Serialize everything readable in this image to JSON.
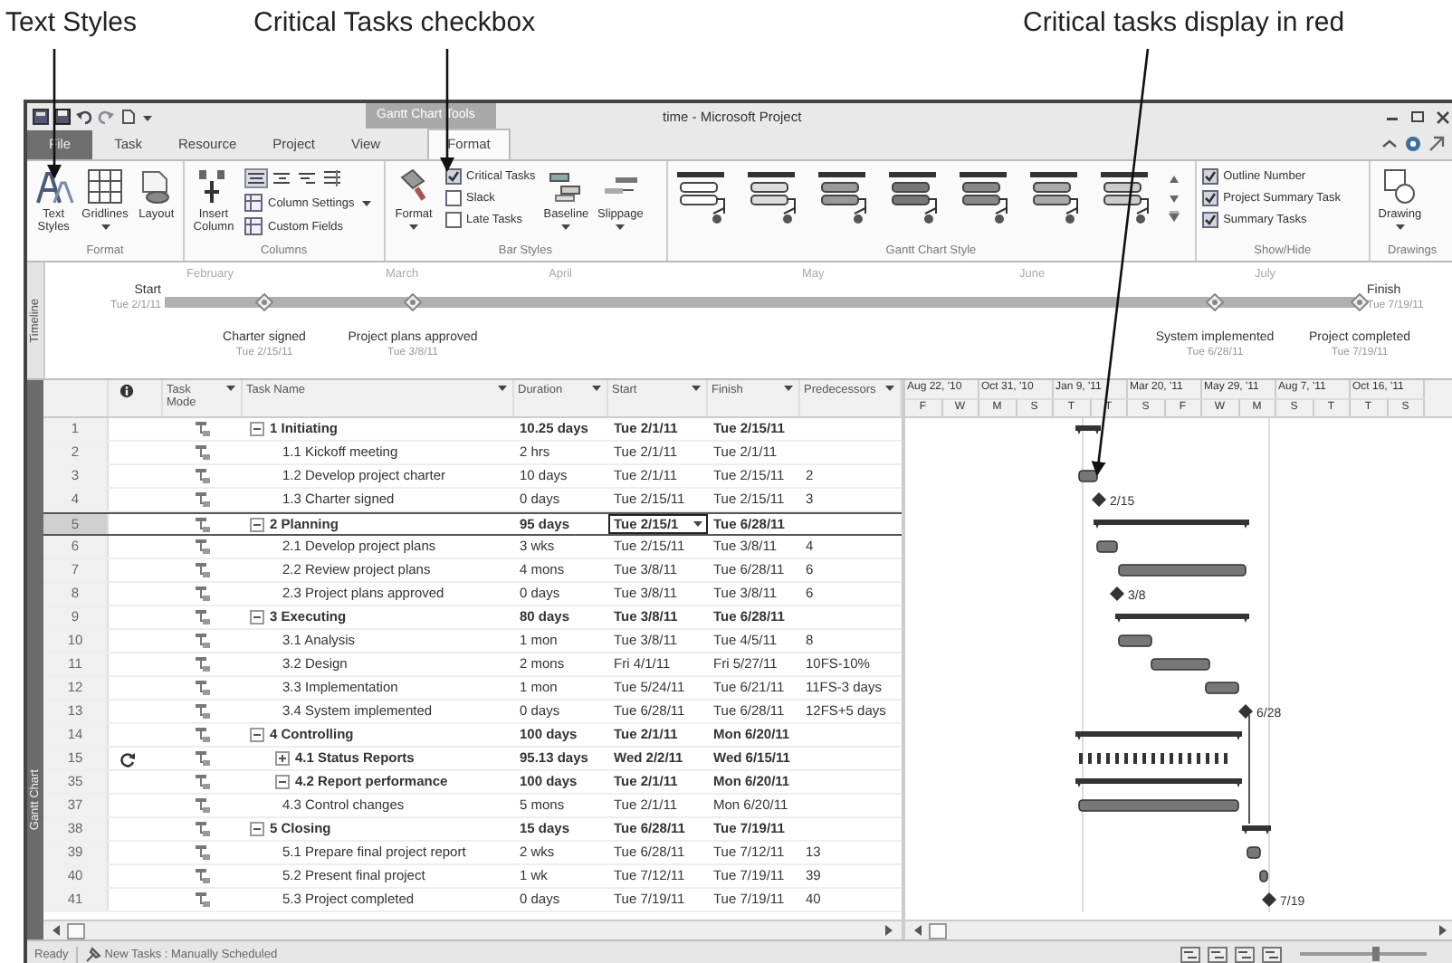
{
  "callouts": [
    {
      "text": "Text Styles"
    },
    {
      "text": "Critical Tasks checkbox"
    },
    {
      "text": "Critical tasks display in red"
    }
  ],
  "window": {
    "title": "time - Microsoft Project",
    "context_tab": "Gantt Chart Tools"
  },
  "tabs": [
    {
      "label": "File",
      "kind": "file",
      "selected": false
    },
    {
      "label": "Task",
      "kind": "tab",
      "selected": false
    },
    {
      "label": "Resource",
      "kind": "tab",
      "selected": false
    },
    {
      "label": "Project",
      "kind": "tab",
      "selected": false
    },
    {
      "label": "View",
      "kind": "tab",
      "selected": false
    },
    {
      "label": "Format",
      "kind": "tab",
      "selected": true
    }
  ],
  "ribbon": {
    "groups": [
      {
        "label": "Format",
        "items": [
          {
            "kind": "large",
            "label": "Text Styles",
            "dropdown": false
          },
          {
            "kind": "large",
            "label": "Gridlines",
            "dropdown": true
          },
          {
            "kind": "large",
            "label": "Layout",
            "dropdown": false
          }
        ]
      },
      {
        "label": "Columns",
        "items": [
          {
            "kind": "large",
            "label": "Insert Column",
            "dropdown": false
          },
          {
            "kind": "align"
          },
          {
            "kind": "small",
            "label": "Column Settings",
            "dropdown": true
          },
          {
            "kind": "small",
            "label": "Custom Fields",
            "dropdown": false
          }
        ]
      },
      {
        "label": "Bar Styles",
        "items": [
          {
            "kind": "large",
            "label": "Format",
            "dropdown": true
          },
          {
            "kind": "check",
            "label": "Critical Tasks",
            "checked": true
          },
          {
            "kind": "check",
            "label": "Slack",
            "checked": false
          },
          {
            "kind": "check",
            "label": "Late Tasks",
            "checked": false
          },
          {
            "kind": "large",
            "label": "Baseline",
            "dropdown": true
          },
          {
            "kind": "large",
            "label": "Slippage",
            "dropdown": true
          }
        ]
      },
      {
        "label": "Gantt Chart Style",
        "items": [
          {
            "kind": "gallery"
          }
        ]
      },
      {
        "label": "Show/Hide",
        "items": [
          {
            "kind": "check",
            "label": "Outline Number",
            "checked": true
          },
          {
            "kind": "check",
            "label": "Project Summary Task",
            "checked": true
          },
          {
            "kind": "check",
            "label": "Summary Tasks",
            "checked": true
          }
        ]
      },
      {
        "label": "Drawings",
        "items": [
          {
            "kind": "large",
            "label": "Drawing",
            "dropdown": true
          }
        ]
      }
    ]
  },
  "timeline": {
    "side_label": "Timeline",
    "months": [
      "February",
      "March",
      "April",
      "May",
      "June",
      "July"
    ],
    "start": {
      "label": "Start",
      "date": "Tue 2/1/11"
    },
    "finish": {
      "label": "Finish",
      "date": "Tue 7/19/11"
    },
    "milestones": [
      {
        "name": "Charter signed",
        "date": "Tue 2/15/11"
      },
      {
        "name": "Project plans approved",
        "date": "Tue 3/8/11"
      },
      {
        "name": "System implemented",
        "date": "Tue 6/28/11"
      },
      {
        "name": "Project completed",
        "date": "Tue 7/19/11"
      }
    ]
  },
  "view_bar": {
    "label": "Gantt Chart"
  },
  "table": {
    "columns": [
      {
        "kind": "indicator"
      },
      {
        "kind": "text",
        "label": "Task Mode"
      },
      {
        "kind": "text",
        "label": "Task Name"
      },
      {
        "kind": "text",
        "label": "Duration"
      },
      {
        "kind": "text",
        "label": "Start"
      },
      {
        "kind": "text",
        "label": "Finish"
      },
      {
        "kind": "text",
        "label": "Predecessors"
      }
    ],
    "rows": [
      {
        "id": "1",
        "name": "1 Initiating",
        "duration": "10.25 days",
        "start": "Tue 2/1/11",
        "finish": "Tue 2/15/11",
        "summary": true,
        "expanded": true,
        "recurring": false,
        "selected": false,
        "children": [
          {
            "id": "2",
            "name": "1.1 Kickoff meeting",
            "duration": "2 hrs",
            "start": "Tue 2/1/11",
            "finish": "Tue 2/1/11",
            "summary": false,
            "recurring": false,
            "selected": false
          },
          {
            "id": "3",
            "name": "1.2 Develop project charter",
            "duration": "10 days",
            "start": "Tue 2/1/11",
            "finish": "Tue 2/15/11",
            "predecessors": "2",
            "summary": false,
            "recurring": false,
            "selected": false
          },
          {
            "id": "4",
            "name": "1.3 Charter signed",
            "duration": "0 days",
            "start": "Tue 2/15/11",
            "finish": "Tue 2/15/11",
            "predecessors": "3",
            "summary": false,
            "recurring": false,
            "selected": false,
            "gantt_label": "2/15"
          }
        ]
      },
      {
        "id": "5",
        "name": "2 Planning",
        "duration": "95 days",
        "start": "Tue 2/15/1",
        "finish": "Tue 6/28/11",
        "summary": true,
        "expanded": true,
        "recurring": false,
        "selected": true,
        "children": [
          {
            "id": "6",
            "name": "2.1 Develop project plans",
            "duration": "3 wks",
            "start": "Tue 2/15/11",
            "finish": "Tue 3/8/11",
            "predecessors": "4",
            "summary": false,
            "recurring": false,
            "selected": false
          },
          {
            "id": "7",
            "name": "2.2 Review project plans",
            "duration": "4 mons",
            "start": "Tue 3/8/11",
            "finish": "Tue 6/28/11",
            "predecessors": "6",
            "summary": false,
            "recurring": false,
            "selected": false
          },
          {
            "id": "8",
            "name": "2.3 Project plans approved",
            "duration": "0 days",
            "start": "Tue 3/8/11",
            "finish": "Tue 3/8/11",
            "predecessors": "6",
            "summary": false,
            "recurring": false,
            "selected": false,
            "gantt_label": "3/8"
          }
        ]
      },
      {
        "id": "9",
        "name": "3 Executing",
        "duration": "80 days",
        "start": "Tue 3/8/11",
        "finish": "Tue 6/28/11",
        "summary": true,
        "expanded": true,
        "recurring": false,
        "selected": false,
        "children": [
          {
            "id": "10",
            "name": "3.1 Analysis",
            "duration": "1 mon",
            "start": "Tue 3/8/11",
            "finish": "Tue 4/5/11",
            "predecessors": "8",
            "summary": false,
            "recurring": false,
            "selected": false
          },
          {
            "id": "11",
            "name": "3.2 Design",
            "duration": "2 mons",
            "start": "Fri 4/1/11",
            "finish": "Fri 5/27/11",
            "predecessors": "10FS-10%",
            "summary": false,
            "recurring": false,
            "selected": false
          },
          {
            "id": "12",
            "name": "3.3 Implementation",
            "duration": "1 mon",
            "start": "Tue 5/24/11",
            "finish": "Tue 6/21/11",
            "predecessors": "11FS-3 days",
            "summary": false,
            "recurring": false,
            "selected": false
          },
          {
            "id": "13",
            "name": "3.4 System implemented",
            "duration": "0 days",
            "start": "Tue 6/28/11",
            "finish": "Tue 6/28/11",
            "predecessors": "12FS+5 days",
            "summary": false,
            "recurring": false,
            "selected": false,
            "gantt_label": "6/28"
          }
        ]
      },
      {
        "id": "14",
        "name": "4 Controlling",
        "duration": "100 days",
        "start": "Tue 2/1/11",
        "finish": "Mon 6/20/11",
        "summary": true,
        "expanded": true,
        "recurring": false,
        "selected": false,
        "children": [
          {
            "id": "15",
            "name": "4.1 Status Reports",
            "duration": "95.13 days",
            "start": "Wed 2/2/11",
            "finish": "Wed 6/15/11",
            "summary": true,
            "expanded": false,
            "recurring": true,
            "selected": false
          },
          {
            "id": "35",
            "name": "4.2 Report performance",
            "duration": "100 days",
            "start": "Tue 2/1/11",
            "finish": "Mon 6/20/11",
            "summary": true,
            "expanded": true,
            "recurring": false,
            "selected": false
          },
          {
            "id": "37",
            "name": "4.3 Control changes",
            "duration": "5 mons",
            "start": "Tue 2/1/11",
            "finish": "Mon 6/20/11",
            "summary": false,
            "recurring": false,
            "selected": false
          }
        ]
      },
      {
        "id": "38",
        "name": "5 Closing",
        "duration": "15 days",
        "start": "Tue 6/28/11",
        "finish": "Tue 7/19/11",
        "summary": true,
        "expanded": true,
        "recurring": false,
        "selected": false,
        "children": [
          {
            "id": "39",
            "name": "5.1 Prepare final project report",
            "duration": "2 wks",
            "start": "Tue 6/28/11",
            "finish": "Tue 7/12/11",
            "predecessors": "13",
            "summary": false,
            "recurring": false,
            "selected": false
          },
          {
            "id": "40",
            "name": "5.2 Present final project",
            "duration": "1 wk",
            "start": "Tue 7/12/11",
            "finish": "Tue 7/19/11",
            "predecessors": "39",
            "summary": false,
            "recurring": false,
            "selected": false
          },
          {
            "id": "41",
            "name": "5.3 Project completed",
            "duration": "0 days",
            "start": "Tue 7/19/11",
            "finish": "Tue 7/19/11",
            "predecessors": "40",
            "summary": false,
            "recurring": false,
            "selected": false,
            "gantt_label": "7/19"
          }
        ]
      }
    ]
  },
  "gantt": {
    "major": [
      "Aug 22, '10",
      "Oct 31, '10",
      "Jan 9, '11",
      "Mar 20, '11",
      "May 29, '11",
      "Aug 7, '11",
      "Oct 16, '11"
    ],
    "minor": [
      "F",
      "W",
      "M",
      "S",
      "T",
      "T",
      "S",
      "F",
      "W",
      "M",
      "S",
      "T",
      "T",
      "S"
    ]
  },
  "status_bar": {
    "ready": "Ready",
    "new_tasks": "New Tasks : Manually Scheduled",
    "zoom": {
      "level": 0.6
    }
  }
}
